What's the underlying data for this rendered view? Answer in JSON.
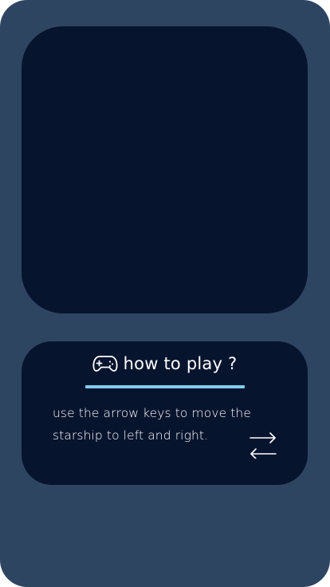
{
  "how_to_play": {
    "title": "how to play ?",
    "instructions": "use the arrow keys to move the starship to left and right.",
    "title_icon": "gamepad-icon",
    "hint_icon": "left-right-arrows-icon"
  },
  "colors": {
    "frame": "#2e4562",
    "panel": "#07142e",
    "accent": "#7fcdee",
    "text": "#ffffff"
  }
}
